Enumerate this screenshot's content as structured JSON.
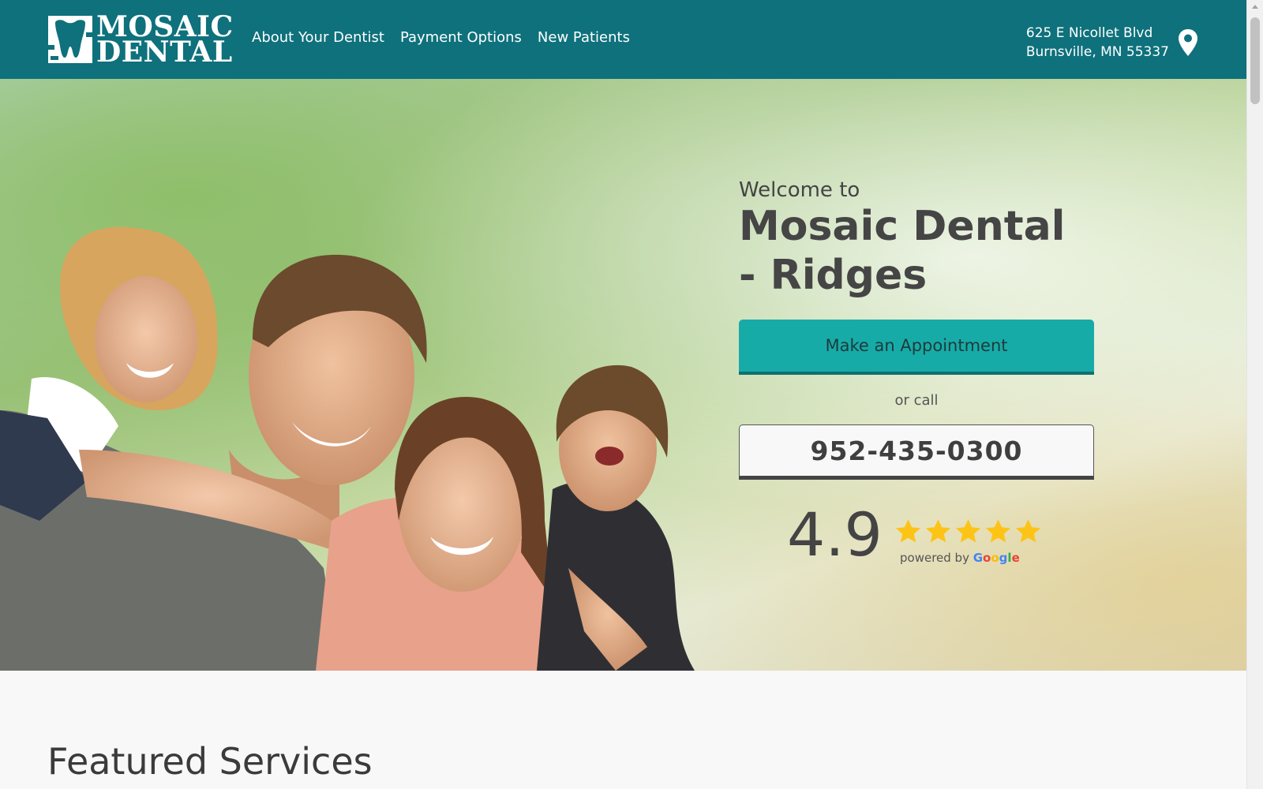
{
  "header": {
    "logo": {
      "line1": "MOSAIC",
      "line2": "DENTAL",
      "icon": "tooth-logo-icon"
    },
    "nav": [
      {
        "label": "About Your Dentist"
      },
      {
        "label": "Payment Options"
      },
      {
        "label": "New Patients"
      }
    ],
    "address": {
      "line1": "625 E Nicollet Blvd",
      "line2": "Burnsville, MN 55337",
      "icon": "map-pin-icon"
    },
    "background_color": "#0e717c"
  },
  "hero": {
    "welcome": "Welcome to",
    "practice_name": "Mosaic Dental - Ridges",
    "appointment_button": "Make an Appointment",
    "or_call": "or call",
    "phone": "952-435-0300",
    "rating": {
      "score": "4.9",
      "stars": 5,
      "powered_by": "powered by",
      "provider": "Google"
    },
    "accent_color": "#17aba8"
  },
  "sections": {
    "featured_title": "Featured Services"
  }
}
